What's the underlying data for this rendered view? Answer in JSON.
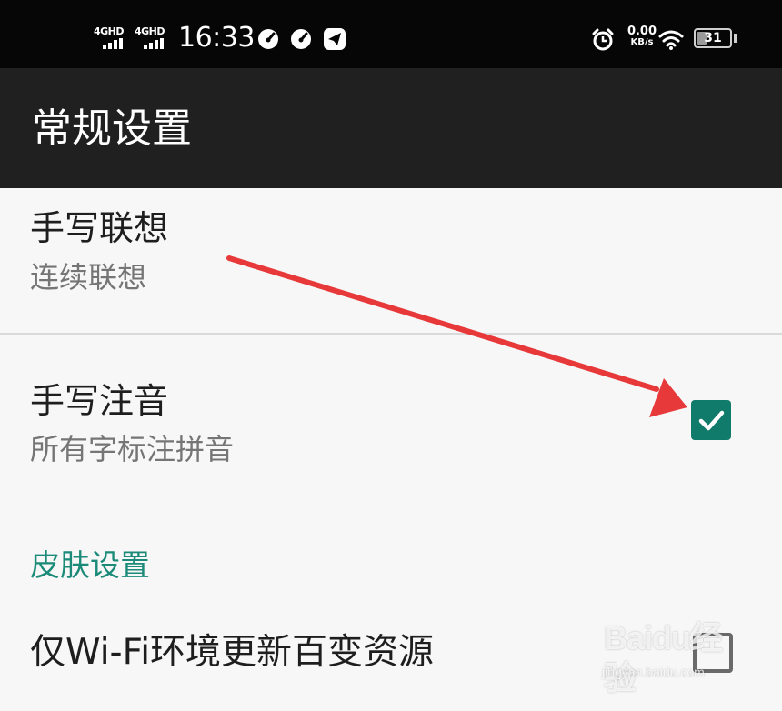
{
  "status_bar": {
    "network_1": "4GHD",
    "network_2": "4GHD",
    "time": "16:33",
    "net_speed_value": "0.00",
    "net_speed_unit": "KB/s",
    "battery_level": "31",
    "icons": [
      "signal-icon",
      "signal-icon",
      "speedometer-icon",
      "speedometer-icon",
      "telegram-icon",
      "alarm-clock-icon",
      "wifi-icon",
      "battery-icon"
    ]
  },
  "app_bar": {
    "title": "常规设置"
  },
  "settings": {
    "handwriting_association": {
      "title": "手写联想",
      "summary": "连续联想"
    },
    "handwriting_pinyin": {
      "title": "手写注音",
      "summary": "所有字标注拼音",
      "checked": true
    },
    "skin_category": {
      "label": "皮肤设置"
    },
    "wifi_only_update": {
      "title": "仅Wi-Fi环境更新百变资源",
      "checked": false
    }
  },
  "annotation": {
    "arrow_color": "#e8393a"
  },
  "watermark": {
    "brand": "Baidu经验",
    "url": "jingyan.baidu.com"
  },
  "colors": {
    "accent": "#117b6b",
    "category_text": "#1b8a78",
    "app_bar_bg": "#202020",
    "status_bar_bg": "#060606",
    "page_bg": "#f7f7f7"
  }
}
